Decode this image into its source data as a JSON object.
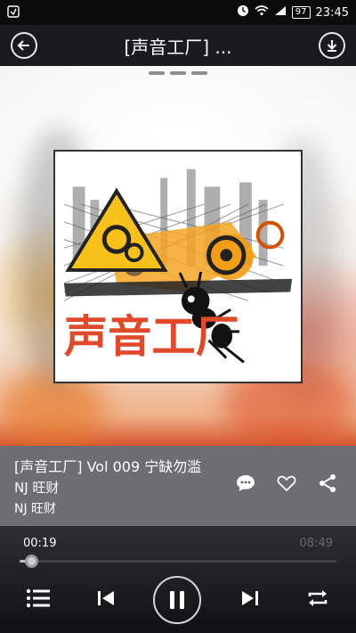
{
  "status_bar": {
    "battery": "97",
    "time": "23:45"
  },
  "header": {
    "title": "[声音工厂] ..."
  },
  "album": {
    "logo_text": "声音工厂"
  },
  "track": {
    "title": "[声音工厂] Vol 009 宁缺勿滥",
    "artist": "NJ 旺财",
    "album_artist": "NJ 旺财"
  },
  "player": {
    "current_time": "00:19",
    "total_time": "08:49",
    "progress_fraction": 0.036
  },
  "icons": {
    "back": "back-arrow-icon",
    "download": "download-icon",
    "comment": "comment-icon",
    "favorite": "heart-icon",
    "share": "share-icon",
    "playlist": "playlist-icon",
    "previous": "previous-track-icon",
    "pause": "pause-icon",
    "next": "next-track-icon",
    "repeat": "repeat-icon"
  },
  "colors": {
    "accent_red": "#e2492a",
    "accent_orange": "#f5a623",
    "panel": "#6d6d72"
  }
}
